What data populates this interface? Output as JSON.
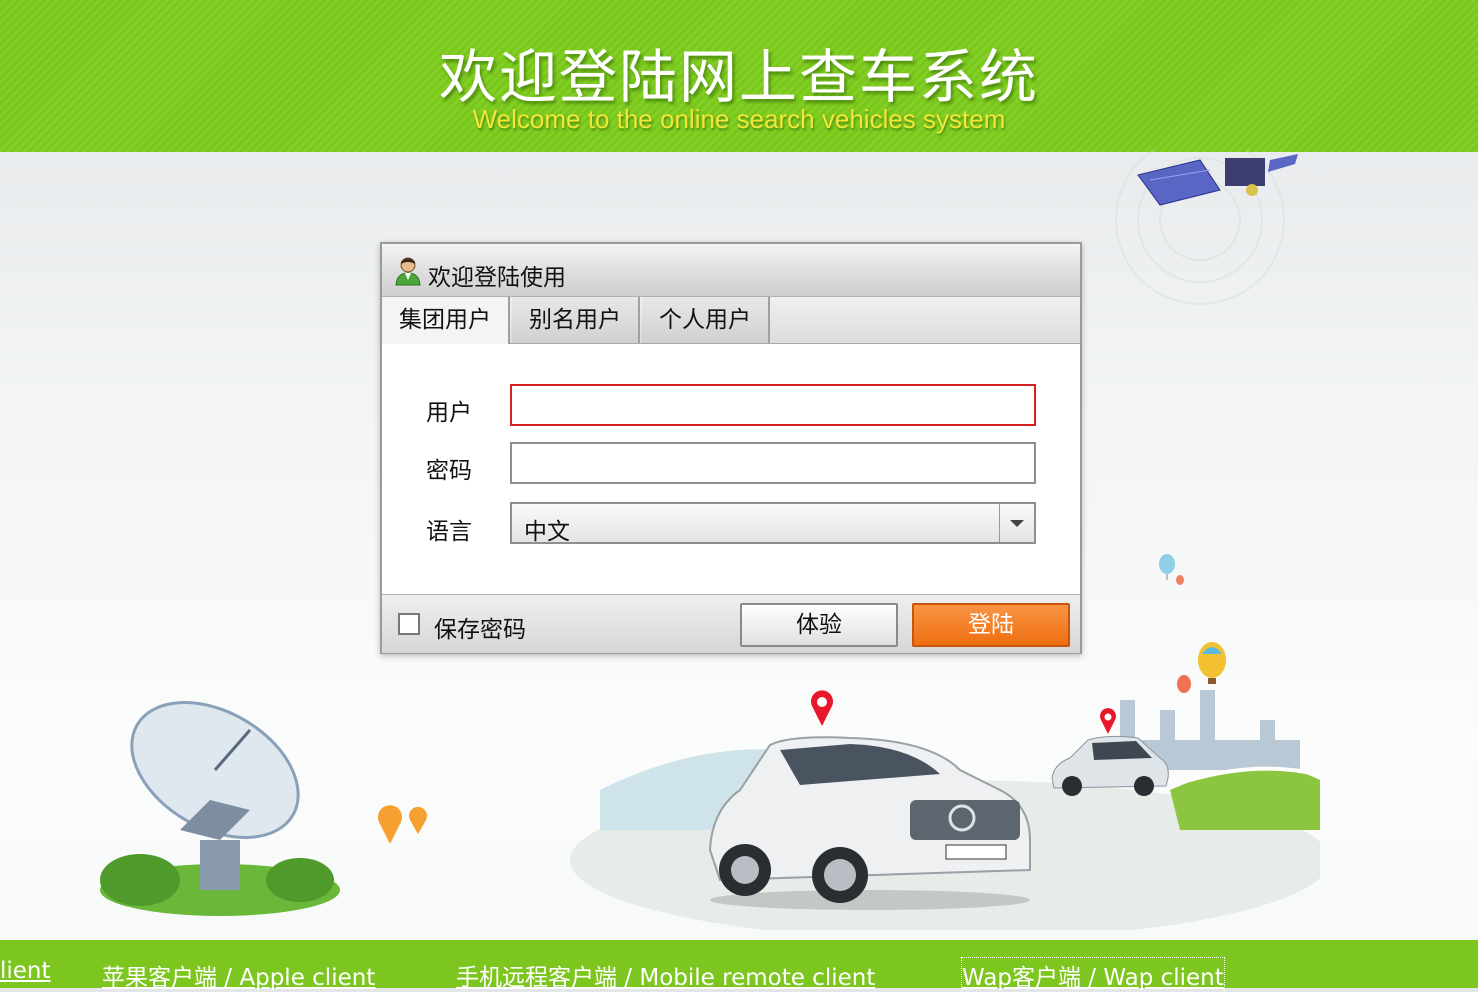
{
  "header": {
    "title": "欢迎登陆网上查车系统",
    "subtitle": "Welcome to the online search vehicles system"
  },
  "dialog": {
    "title": "欢迎登陆使用",
    "tabs": [
      {
        "label": "集团用户",
        "active": true
      },
      {
        "label": "别名用户",
        "active": false
      },
      {
        "label": "个人用户",
        "active": false
      }
    ],
    "fields": {
      "user_label": "用户",
      "user_value": "",
      "password_label": "密码",
      "password_value": "",
      "language_label": "语言",
      "language_value": "中文"
    },
    "remember_label": "保存密码",
    "trial_button": "体验",
    "login_button": "登陆"
  },
  "footer": {
    "links": [
      "lient",
      "苹果客户端  / Apple client",
      "手机远程客户端  /  Mobile remote client",
      "Wap客户端  /  Wap client"
    ]
  },
  "colors": {
    "header_green": "#79c71c",
    "subtitle_yellow": "#f2e63a",
    "focus_red": "#d42020",
    "login_orange": "#ee6f12"
  },
  "icons": [
    "user-avatar-icon",
    "dropdown-arrow-icon",
    "satellite-icon",
    "satellite-dish-icon",
    "car-icon",
    "map-pin-icon",
    "balloon-icon"
  ]
}
